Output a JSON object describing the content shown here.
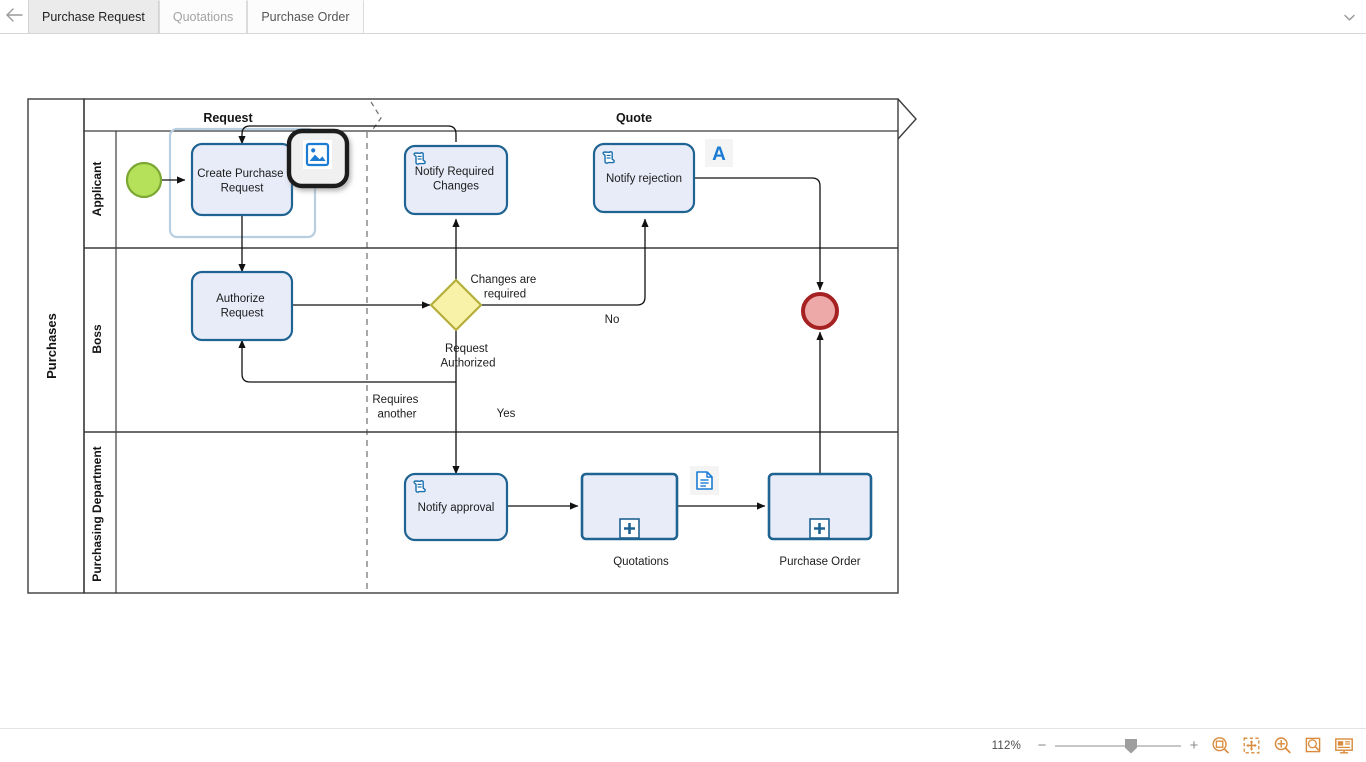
{
  "window": {
    "back_icon": "back-arrow-icon",
    "overflow_icon": "chevron-down-icon"
  },
  "tabs": [
    {
      "label": "Purchase Request",
      "active": true
    },
    {
      "label": "Quotations",
      "active": false
    },
    {
      "label": "Purchase Order",
      "active": false
    }
  ],
  "statusbar": {
    "zoom_level": "112%",
    "zoom_out_label": "−",
    "zoom_in_label": "+",
    "icons": [
      {
        "name": "fit-page-icon",
        "title": "Fit page"
      },
      {
        "name": "fit-width-icon",
        "title": "Fit width"
      },
      {
        "name": "zoom-in-icon",
        "title": "Zoom in"
      },
      {
        "name": "zoom-selection-icon",
        "title": "Zoom selection"
      },
      {
        "name": "presentation-mode-icon",
        "title": "Presentation mode"
      }
    ]
  },
  "diagram": {
    "pool_label": "Purchases",
    "lanes": [
      {
        "label": "Applicant"
      },
      {
        "label": "Boss"
      },
      {
        "label": "Purchasing Department"
      }
    ],
    "phases": [
      {
        "label": "Request"
      },
      {
        "label": "Quote"
      }
    ],
    "tasks": [
      {
        "id": "create-purchase-request",
        "label": "Create Purchase Request",
        "icon": "none"
      },
      {
        "id": "authorize-request",
        "label": "Authorize Request",
        "icon": "none"
      },
      {
        "id": "notify-required-changes",
        "label": "Notify Required Changes",
        "icon": "script-task-icon"
      },
      {
        "id": "notify-rejection",
        "label": "Notify rejection",
        "icon": "script-task-icon"
      },
      {
        "id": "notify-approval",
        "label": "Notify approval",
        "icon": "script-task-icon"
      }
    ],
    "subprocesses": [
      {
        "id": "quotations",
        "label": "Quotations",
        "marker": "collapsed-plus-icon"
      },
      {
        "id": "purchase-order",
        "label": "Purchase Order",
        "marker": "collapsed-plus-icon"
      }
    ],
    "gateway": {
      "id": "request-authorized",
      "label": "Request Authorized"
    },
    "flow_labels": [
      {
        "id": "changes-are-required",
        "text": "Changes are required"
      },
      {
        "id": "no",
        "text": "No"
      },
      {
        "id": "requires-another",
        "text": "Requires another"
      },
      {
        "id": "yes",
        "text": "Yes"
      }
    ],
    "events": [
      {
        "id": "start-event",
        "type": "start"
      },
      {
        "id": "end-event",
        "type": "end"
      }
    ],
    "floating_icons": [
      {
        "id": "image-tool",
        "name": "image-icon",
        "glyph": "image"
      },
      {
        "id": "text-tool",
        "name": "text-annotation-icon",
        "glyph": "A"
      },
      {
        "id": "document-tool",
        "name": "document-icon",
        "glyph": "document"
      }
    ],
    "colors": {
      "task_fill": "#e8ecf9",
      "task_stroke": "#1f6392",
      "gateway_fill": "#f7f2a8",
      "gateway_stroke": "#b5ae3a",
      "start_fill": "#b4e05a",
      "start_stroke": "#7ba832",
      "end_fill": "#eda8a8",
      "end_stroke": "#a62222",
      "group_stroke": "#b7cfe0",
      "accent_blue": "#1a7bd4"
    }
  }
}
